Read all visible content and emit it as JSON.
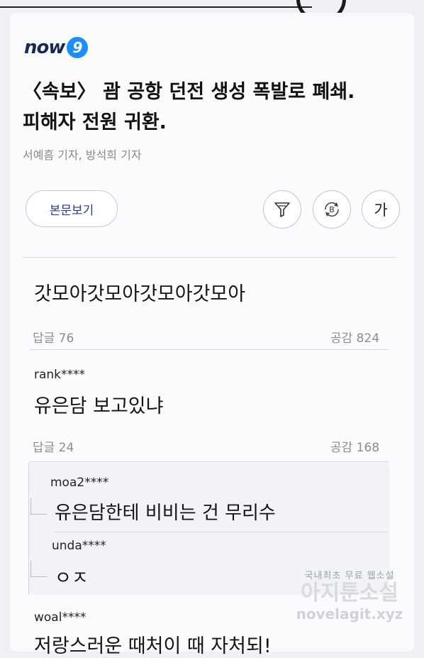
{
  "brand": {
    "name": "now",
    "badge": "9"
  },
  "article": {
    "headline_line1": "〈속보〉 괌 공항 던전 생성 폭발로 폐쇄.",
    "headline_line2": "피해자 전원 귀환.",
    "byline": "서예흠 기자, 방석희 기자"
  },
  "toolbar": {
    "view_body_label": "본문보기",
    "font_size_label": "가",
    "filter_icon": "filter-icon",
    "refresh_icon": "b-refresh-icon"
  },
  "comments": [
    {
      "username": "",
      "text": "갓모아갓모아갓모아갓모아",
      "replies_label": "답글 76",
      "likes_label": "공감 824"
    },
    {
      "username": "rank****",
      "text": "유은담 보고있냐",
      "replies_label": "답글 24",
      "likes_label": "공감 168",
      "replies": [
        {
          "username": "moa2****",
          "text": "유은담한테 비비는 건 무리수"
        },
        {
          "username": "unda****",
          "text": "ㅇㅈ"
        }
      ]
    },
    {
      "username": "woal****",
      "text": "저랑스러운 때처이 때 자처되!"
    }
  ],
  "watermark": {
    "line1": "국내최초 무료 웹소설",
    "line2": "아지툰소설",
    "line3": "novelagit.xyz"
  },
  "colors": {
    "accent": "#1d8ff2",
    "brand_text": "#1b2a4a",
    "button_text": "#2f3a78"
  }
}
